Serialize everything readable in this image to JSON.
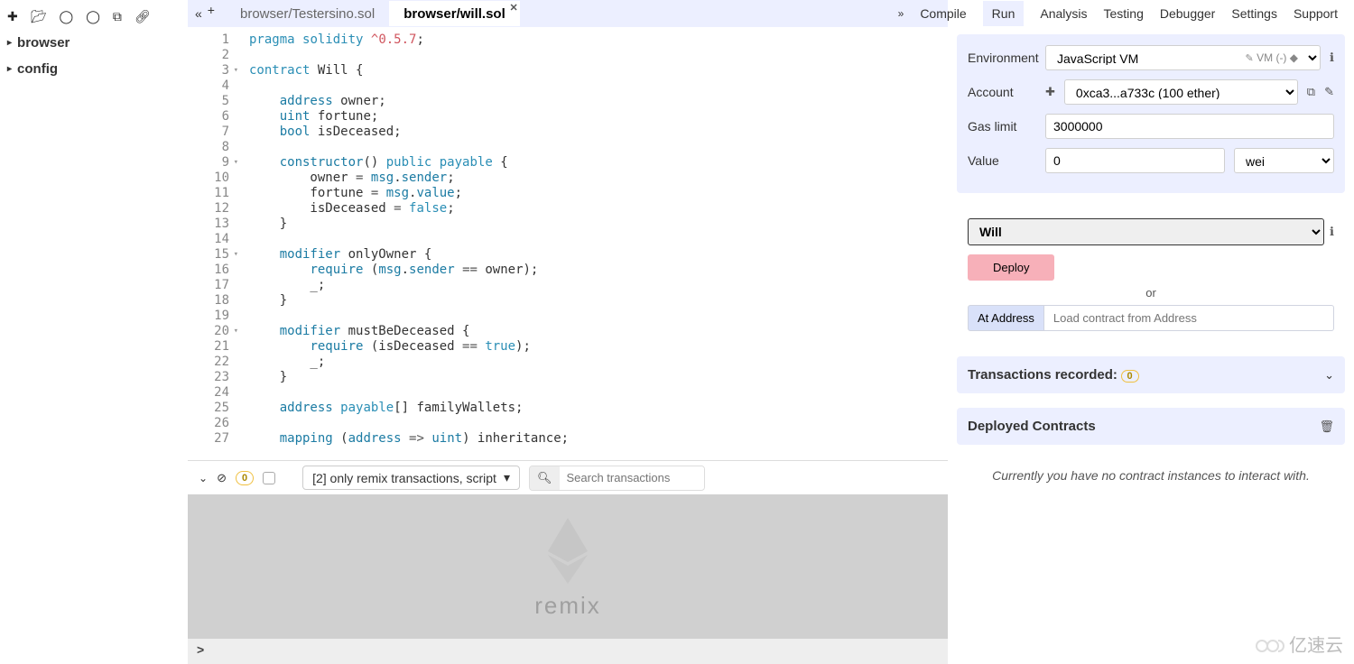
{
  "fileBrowser": {
    "folders": [
      "browser",
      "config"
    ]
  },
  "tabs": [
    {
      "label": "browser/Testersino.sol",
      "active": false
    },
    {
      "label": "browser/will.sol",
      "active": true
    }
  ],
  "editor": {
    "lines": [
      {
        "n": 1,
        "fold": false,
        "tokens": [
          [
            "kw",
            "pragma"
          ],
          [
            "",
            " "
          ],
          [
            "kw",
            "solidity"
          ],
          [
            "",
            " "
          ],
          [
            "version",
            "^0.5.7"
          ],
          [
            "",
            ";"
          ]
        ]
      },
      {
        "n": 2,
        "fold": false,
        "tokens": []
      },
      {
        "n": 3,
        "fold": true,
        "tokens": [
          [
            "kw",
            "contract"
          ],
          [
            "",
            " Will {"
          ]
        ]
      },
      {
        "n": 4,
        "fold": false,
        "tokens": []
      },
      {
        "n": 5,
        "fold": false,
        "tokens": [
          [
            "",
            "    "
          ],
          [
            "decl",
            "address"
          ],
          [
            "",
            " owner;"
          ]
        ]
      },
      {
        "n": 6,
        "fold": false,
        "tokens": [
          [
            "",
            "    "
          ],
          [
            "decl",
            "uint"
          ],
          [
            "",
            " fortune;"
          ]
        ]
      },
      {
        "n": 7,
        "fold": false,
        "tokens": [
          [
            "",
            "    "
          ],
          [
            "decl",
            "bool"
          ],
          [
            "",
            " isDeceased;"
          ]
        ]
      },
      {
        "n": 8,
        "fold": false,
        "tokens": []
      },
      {
        "n": 9,
        "fold": true,
        "tokens": [
          [
            "",
            "    "
          ],
          [
            "decl",
            "constructor"
          ],
          [
            "",
            "() "
          ],
          [
            "kw",
            "public"
          ],
          [
            "",
            " "
          ],
          [
            "kw",
            "payable"
          ],
          [
            "",
            " {"
          ]
        ]
      },
      {
        "n": 10,
        "fold": false,
        "tokens": [
          [
            "",
            "        owner "
          ],
          [
            "paren",
            "="
          ],
          [
            "",
            " "
          ],
          [
            "msg",
            "msg"
          ],
          [
            "",
            "."
          ],
          [
            "msg",
            "sender"
          ],
          [
            "",
            ";"
          ]
        ]
      },
      {
        "n": 11,
        "fold": false,
        "tokens": [
          [
            "",
            "        fortune "
          ],
          [
            "paren",
            "="
          ],
          [
            "",
            " "
          ],
          [
            "msg",
            "msg"
          ],
          [
            "",
            "."
          ],
          [
            "msg",
            "value"
          ],
          [
            "",
            ";"
          ]
        ]
      },
      {
        "n": 12,
        "fold": false,
        "tokens": [
          [
            "",
            "        isDeceased "
          ],
          [
            "paren",
            "="
          ],
          [
            "",
            " "
          ],
          [
            "bool",
            "false"
          ],
          [
            "",
            ";"
          ]
        ]
      },
      {
        "n": 13,
        "fold": false,
        "tokens": [
          [
            "",
            "    }"
          ]
        ]
      },
      {
        "n": 14,
        "fold": false,
        "tokens": []
      },
      {
        "n": 15,
        "fold": true,
        "tokens": [
          [
            "",
            "    "
          ],
          [
            "decl",
            "modifier"
          ],
          [
            "",
            " onlyOwner {"
          ]
        ]
      },
      {
        "n": 16,
        "fold": false,
        "tokens": [
          [
            "",
            "        "
          ],
          [
            "decl",
            "require"
          ],
          [
            "",
            " ("
          ],
          [
            "msg",
            "msg"
          ],
          [
            "",
            "."
          ],
          [
            "msg",
            "sender"
          ],
          [
            "",
            " "
          ],
          [
            "paren",
            "=="
          ],
          [
            "",
            " owner);"
          ]
        ]
      },
      {
        "n": 17,
        "fold": false,
        "tokens": [
          [
            "",
            "        _;"
          ]
        ]
      },
      {
        "n": 18,
        "fold": false,
        "tokens": [
          [
            "",
            "    }"
          ]
        ]
      },
      {
        "n": 19,
        "fold": false,
        "tokens": []
      },
      {
        "n": 20,
        "fold": true,
        "tokens": [
          [
            "",
            "    "
          ],
          [
            "decl",
            "modifier"
          ],
          [
            "",
            " mustBeDeceased {"
          ]
        ]
      },
      {
        "n": 21,
        "fold": false,
        "tokens": [
          [
            "",
            "        "
          ],
          [
            "decl",
            "require"
          ],
          [
            "",
            " (isDeceased "
          ],
          [
            "paren",
            "=="
          ],
          [
            "",
            " "
          ],
          [
            "bool",
            "true"
          ],
          [
            "",
            ");"
          ]
        ]
      },
      {
        "n": 22,
        "fold": false,
        "tokens": [
          [
            "",
            "        _;"
          ]
        ]
      },
      {
        "n": 23,
        "fold": false,
        "tokens": [
          [
            "",
            "    }"
          ]
        ]
      },
      {
        "n": 24,
        "fold": false,
        "tokens": []
      },
      {
        "n": 25,
        "fold": false,
        "tokens": [
          [
            "",
            "    "
          ],
          [
            "decl",
            "address"
          ],
          [
            "",
            " "
          ],
          [
            "kw",
            "payable"
          ],
          [
            "",
            "[] familyWallets;"
          ]
        ]
      },
      {
        "n": 26,
        "fold": false,
        "tokens": []
      },
      {
        "n": 27,
        "fold": false,
        "tokens": [
          [
            "",
            "    "
          ],
          [
            "decl",
            "mapping"
          ],
          [
            "",
            " ("
          ],
          [
            "decl",
            "address"
          ],
          [
            "",
            " "
          ],
          [
            "paren",
            "=>"
          ],
          [
            "",
            " "
          ],
          [
            "decl",
            "uint"
          ],
          [
            "",
            ") inheritance;"
          ]
        ]
      }
    ]
  },
  "console": {
    "badge": "0",
    "filter": "[2] only remix transactions, script",
    "searchPlaceholder": "Search transactions",
    "logoText": "remix",
    "prompt": ">"
  },
  "menu": {
    "tabs": [
      "Compile",
      "Run",
      "Analysis",
      "Testing",
      "Debugger",
      "Settings",
      "Support"
    ],
    "active": "Run"
  },
  "runPanel": {
    "envLabel": "Environment",
    "envValue": "JavaScript VM",
    "vmTag": "VM (-)",
    "accountLabel": "Account",
    "accountValue": "0xca3...a733c (100 ether)",
    "gasLabel": "Gas limit",
    "gasValue": "3000000",
    "valueLabel": "Value",
    "valueAmount": "0",
    "valueUnit": "wei",
    "contractSel": "Will",
    "deployBtn": "Deploy",
    "orText": "or",
    "atAddressBtn": "At Address",
    "atAddressPlaceholder": "Load contract from Address",
    "txRecorded": "Transactions recorded:",
    "txCount": "0",
    "deployedTitle": "Deployed Contracts",
    "deployedMsg": "Currently you have no contract instances to interact with."
  },
  "watermark": "亿速云"
}
